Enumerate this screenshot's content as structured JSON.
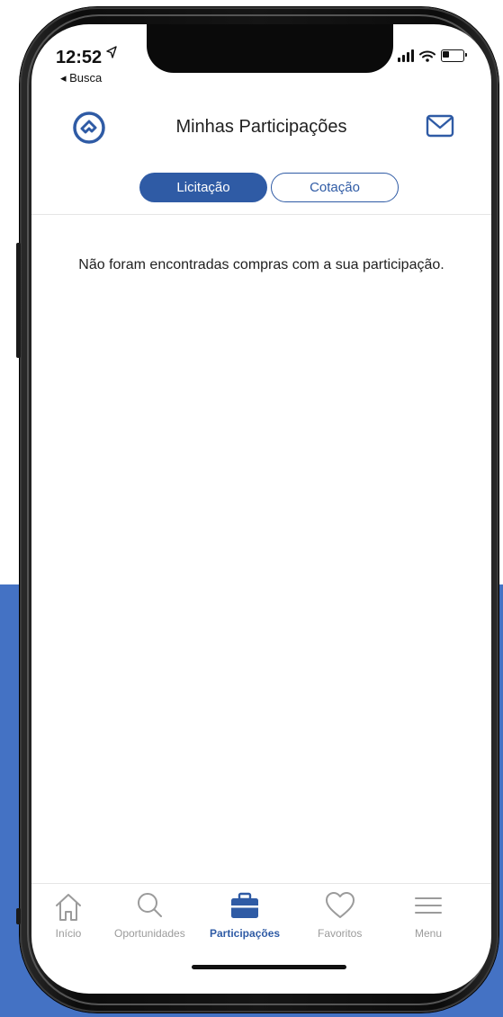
{
  "status_bar": {
    "time": "12:52",
    "location_arrow": "➚",
    "back_label": "◂ Busca"
  },
  "header": {
    "title": "Minhas Participações",
    "logo_icon": "brand-logo-icon",
    "mail_icon": "mail-icon"
  },
  "tabs": [
    {
      "label": "Licitação",
      "active": true
    },
    {
      "label": "Cotação",
      "active": false
    }
  ],
  "empty_message": "Não foram encontradas compras com a sua participação.",
  "bottom_nav": [
    {
      "label": "Início",
      "icon": "home-icon",
      "active": false
    },
    {
      "label": "Oportunidades",
      "icon": "search-icon",
      "active": false
    },
    {
      "label": "Participações",
      "icon": "briefcase-icon",
      "active": true
    },
    {
      "label": "Favoritos",
      "icon": "heart-icon",
      "active": false
    },
    {
      "label": "Menu",
      "icon": "menu-icon",
      "active": false
    }
  ],
  "colors": {
    "accent": "#2f5ba5",
    "background_block": "#4472c4",
    "inactive": "#9b9b9b"
  }
}
